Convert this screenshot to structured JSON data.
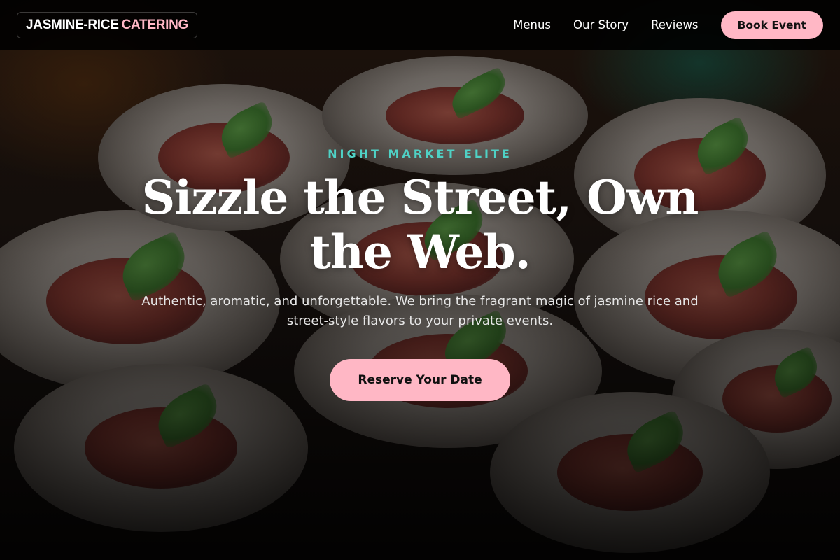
{
  "brand": {
    "part1": "JASMINE-RICE",
    "part2": "CATERING"
  },
  "nav": {
    "items": [
      {
        "label": "Menus"
      },
      {
        "label": "Our Story"
      },
      {
        "label": "Reviews"
      }
    ],
    "cta_label": "Book Event"
  },
  "hero": {
    "eyebrow": "NIGHT MARKET ELITE",
    "headline": "Sizzle the Street, Own the Web.",
    "subtext": "Authentic, aromatic, and unforgettable. We bring the fragrant magic of jasmine rice and street-style flavors to your private events.",
    "cta_label": "Reserve Your Date"
  },
  "colors": {
    "accent_pink": "#ffb7c5",
    "accent_teal": "#4fd1c5",
    "header_bg": "#000000"
  },
  "icons": {
    "background": "food-photo-background"
  }
}
